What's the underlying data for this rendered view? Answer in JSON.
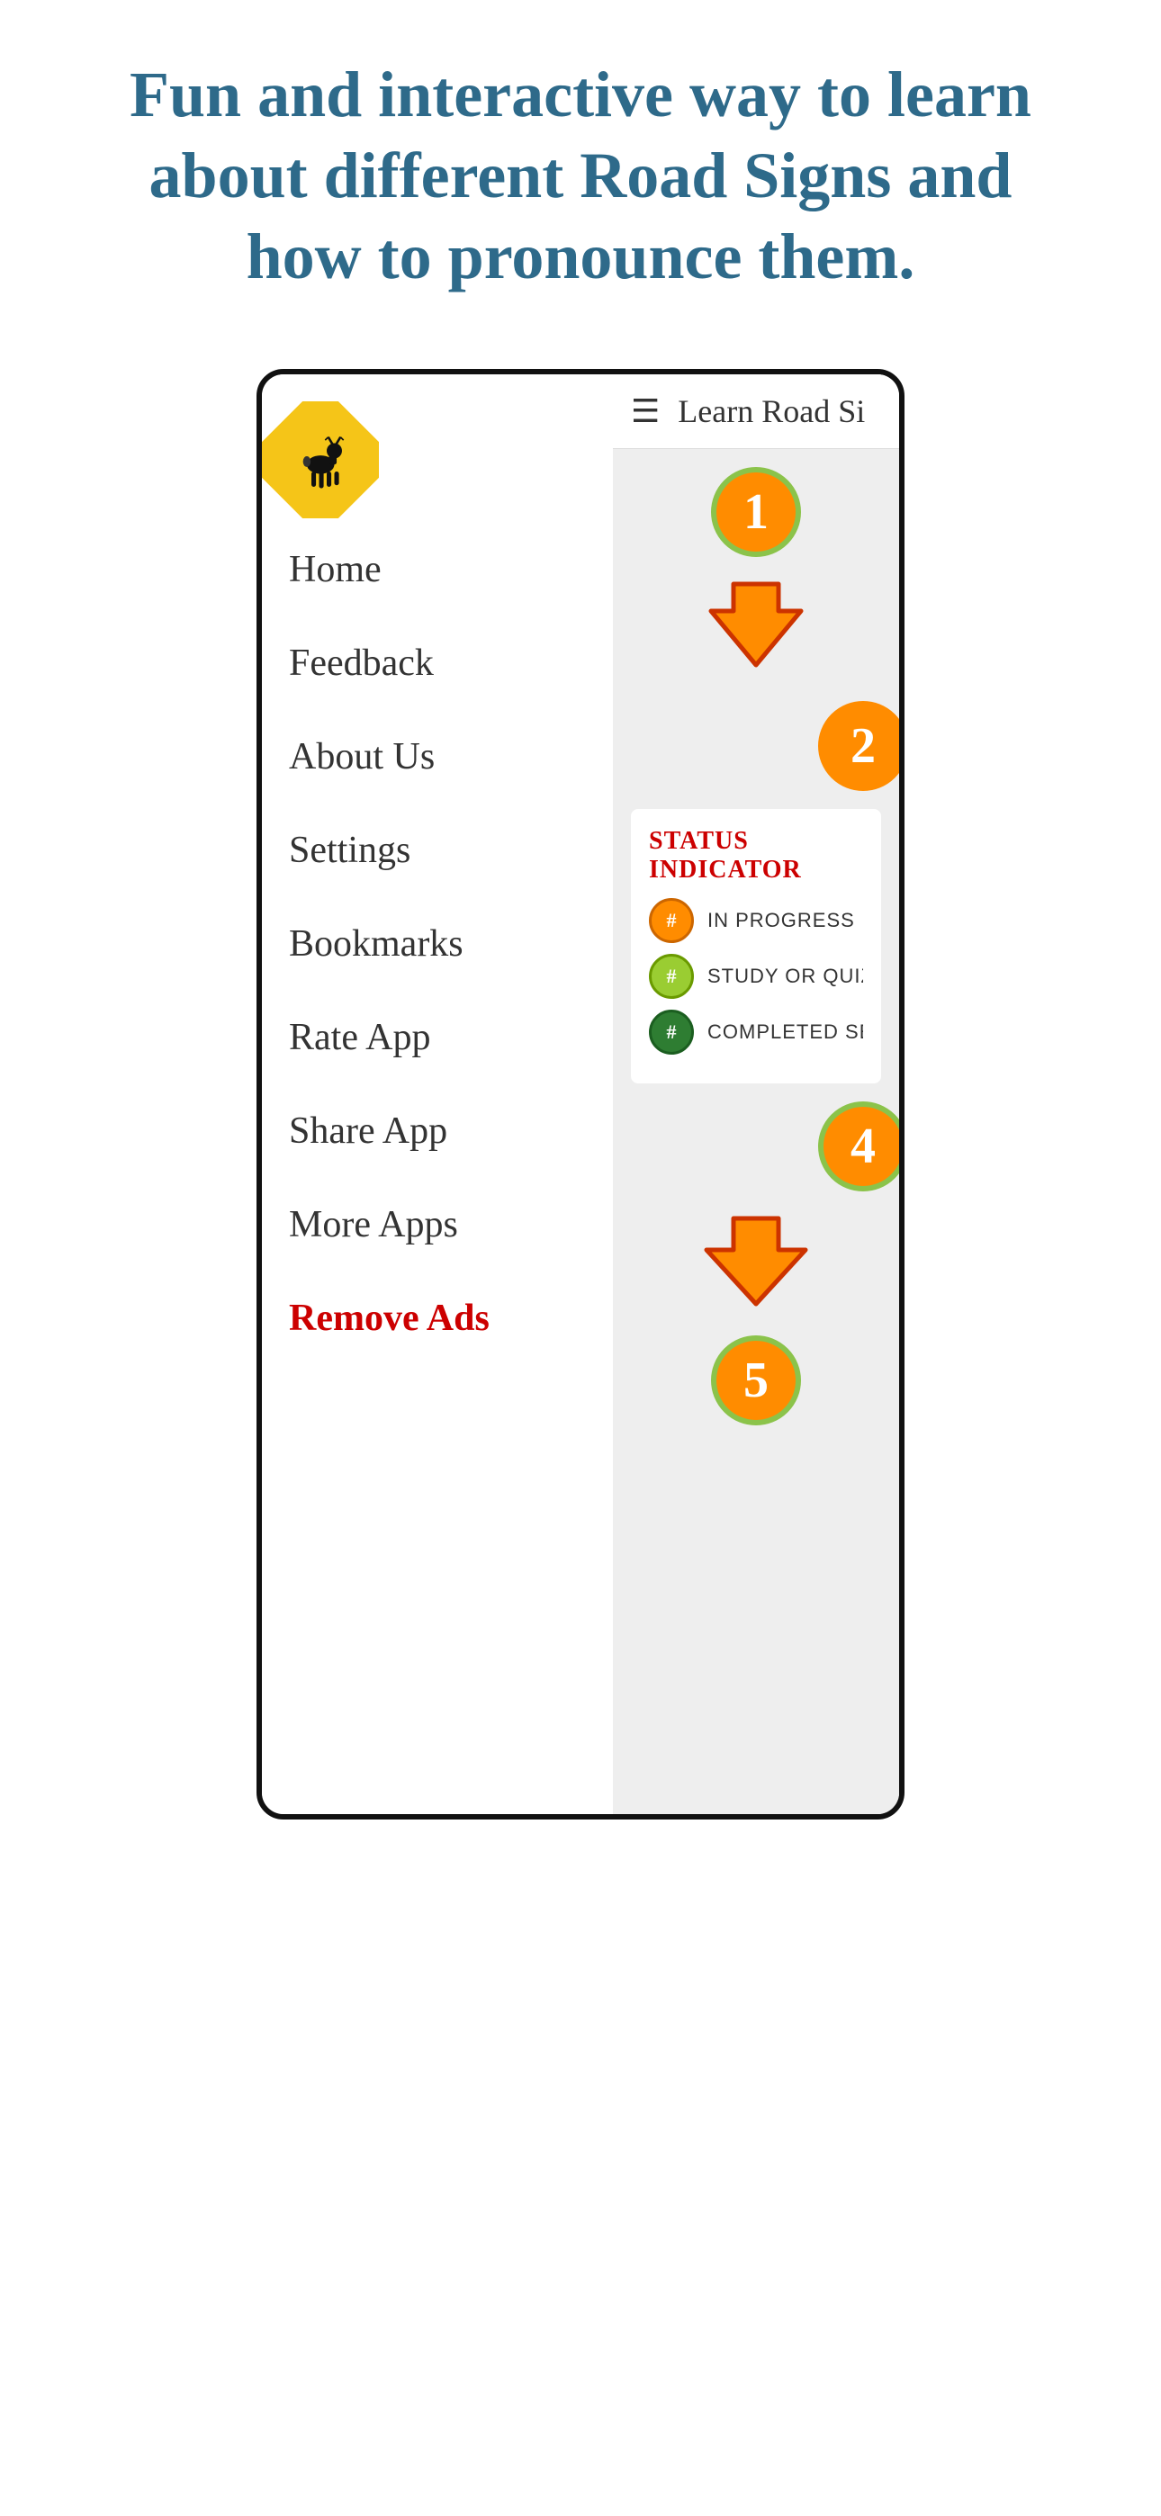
{
  "page": {
    "tagline": "Fun and interactive way to learn about different Road Signs and how to pronounce them."
  },
  "sidebar": {
    "logo_alt": "deer road sign",
    "items": [
      {
        "label": "Home",
        "color": "#333",
        "is_accent": false
      },
      {
        "label": "Feedback",
        "color": "#333",
        "is_accent": false
      },
      {
        "label": "About Us",
        "color": "#333",
        "is_accent": false
      },
      {
        "label": "Settings",
        "color": "#333",
        "is_accent": false
      },
      {
        "label": "Bookmarks",
        "color": "#333",
        "is_accent": false
      },
      {
        "label": "Rate App",
        "color": "#333",
        "is_accent": false
      },
      {
        "label": "Share App",
        "color": "#333",
        "is_accent": false
      },
      {
        "label": "More Apps",
        "color": "#333",
        "is_accent": false
      },
      {
        "label": "Remove Ads",
        "color": "#cc0000",
        "is_accent": true
      }
    ]
  },
  "app_header": {
    "hamburger": "☰",
    "title": "Learn Road Si"
  },
  "status": {
    "title": "STATUS INDICATOR",
    "items": [
      {
        "label": "IN PROGRESS",
        "type": "orange"
      },
      {
        "label": "STUDY OR QUIZ COMP",
        "type": "lime"
      },
      {
        "label": "COMPLETED SECTION",
        "type": "dark-green"
      }
    ]
  },
  "steps": {
    "numbers": [
      "1",
      "2",
      "4",
      "5"
    ]
  }
}
